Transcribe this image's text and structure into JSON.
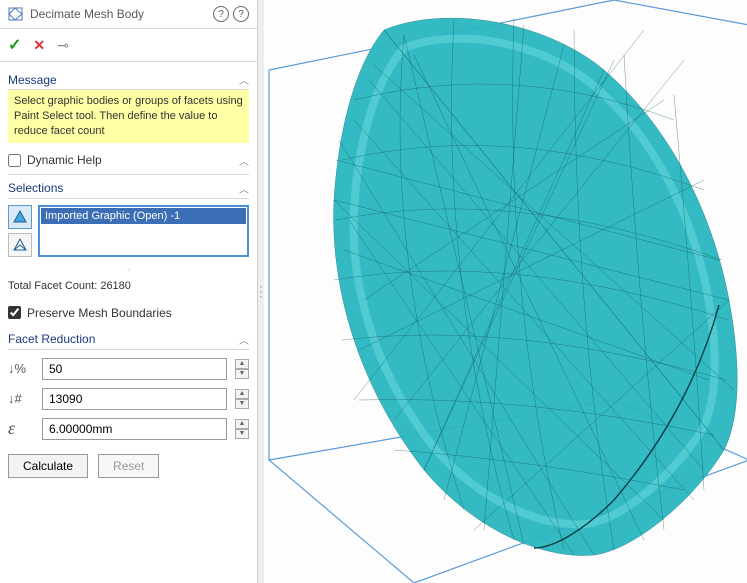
{
  "title": "Decimate Mesh Body",
  "message_header": "Message",
  "message_text": "Select graphic bodies or groups of facets using Paint Select tool. Then define the value to reduce facet count",
  "dynamic_help_label": "Dynamic Help",
  "dynamic_help_checked": false,
  "selections_header": "Selections",
  "selection_items": [
    "Imported Graphic (Open) -1"
  ],
  "facet_count_label": "Total Facet Count: 26180",
  "preserve_label": "Preserve Mesh Boundaries",
  "preserve_checked": true,
  "reduction_header": "Facet Reduction",
  "percent_value": "50",
  "count_value": "13090",
  "epsilon_value": "6.00000mm",
  "calculate_label": "Calculate",
  "reset_label": "Reset"
}
